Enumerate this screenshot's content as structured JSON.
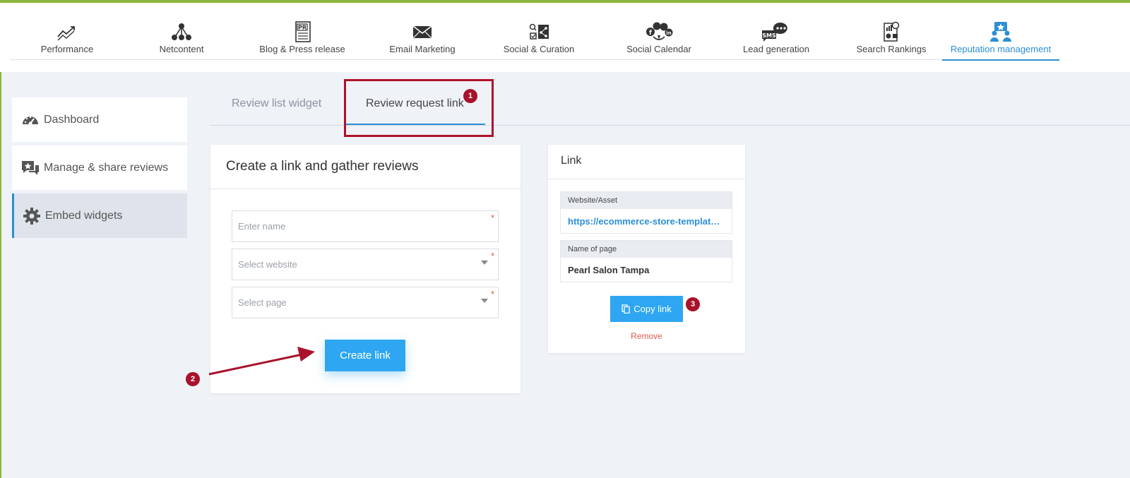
{
  "nav": {
    "items": [
      {
        "label": "Performance",
        "icon": "performance-icon"
      },
      {
        "label": "Netcontent",
        "icon": "netcontent-icon"
      },
      {
        "label": "Blog & Press release",
        "icon": "press-release-icon"
      },
      {
        "label": "Email Marketing",
        "icon": "email-icon"
      },
      {
        "label": "Social & Curation",
        "icon": "social-curation-icon"
      },
      {
        "label": "Social Calendar",
        "icon": "social-calendar-icon"
      },
      {
        "label": "Lead generation",
        "icon": "lead-generation-icon"
      },
      {
        "label": "Search Rankings",
        "icon": "search-rankings-icon"
      },
      {
        "label": "Reputation management",
        "icon": "reputation-icon"
      }
    ],
    "active_index": 8,
    "active_color": "#2b8ed6",
    "sms_badge": "SMS",
    "pr_badge": "PR"
  },
  "sidebar": {
    "items": [
      {
        "label": "Dashboard",
        "icon": "speedometer-icon"
      },
      {
        "label": "Manage & share reviews",
        "icon": "review-chat-icon"
      },
      {
        "label": "Embed widgets",
        "icon": "gear-icon"
      }
    ],
    "active_index": 2
  },
  "tabs": {
    "items": [
      {
        "label": "Review list widget"
      },
      {
        "label": "Review request link"
      }
    ],
    "active_index": 1
  },
  "annotations": {
    "badge1": "1",
    "badge2": "2",
    "badge3": "3",
    "color": "#a8122b"
  },
  "create_card": {
    "title": "Create a link and gather reviews",
    "name_placeholder": "Enter name",
    "website_placeholder": "Select website",
    "page_placeholder": "Select page",
    "required_mark": "*",
    "create_button": "Create link"
  },
  "link_card": {
    "title": "Link",
    "website_label": "Website/Asset",
    "website_value": "https://ecommerce-store-template.…",
    "page_label": "Name of page",
    "page_value": "Pearl Salon Tampa",
    "copy_button": "Copy link",
    "remove_label": "Remove"
  },
  "colors": {
    "accent_green": "#8cb63c",
    "primary_button": "#2ea6f2",
    "background": "#eff2f7"
  }
}
